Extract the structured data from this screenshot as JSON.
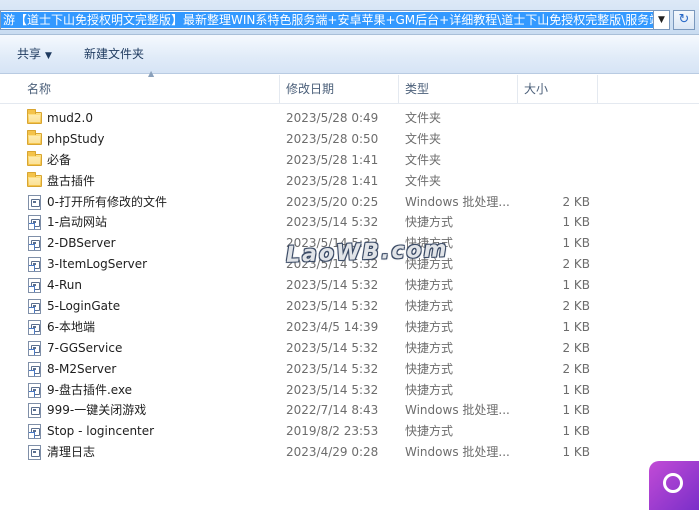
{
  "address_bar": {
    "path": "游【道士下山免授权明文完整版】最新整理WIN系特色服务端+安卓苹果+GM后台+详细教程\\道士下山免授权完整版\\服务端"
  },
  "toolbar": {
    "share_label": "共享",
    "new_folder_label": "新建文件夹"
  },
  "columns": {
    "name": "名称",
    "date": "修改日期",
    "type": "类型",
    "size": "大小"
  },
  "files": [
    {
      "name": "mud2.0",
      "date": "2023/5/28 0:49",
      "type": "文件夹",
      "size": "",
      "icon": "folder-icon"
    },
    {
      "name": "phpStudy",
      "date": "2023/5/28 0:50",
      "type": "文件夹",
      "size": "",
      "icon": "folder-icon"
    },
    {
      "name": "必备",
      "date": "2023/5/28 1:41",
      "type": "文件夹",
      "size": "",
      "icon": "folder-icon"
    },
    {
      "name": "盘古插件",
      "date": "2023/5/28 1:41",
      "type": "文件夹",
      "size": "",
      "icon": "folder-icon"
    },
    {
      "name": "0-打开所有修改的文件",
      "date": "2023/5/20 0:25",
      "type": "Windows 批处理...",
      "size": "2 KB",
      "icon": "batch-icon"
    },
    {
      "name": "1-启动网站",
      "date": "2023/5/14 5:32",
      "type": "快捷方式",
      "size": "1 KB",
      "icon": "shortcut-icon"
    },
    {
      "name": "2-DBServer",
      "date": "2023/5/14 5:32",
      "type": "快捷方式",
      "size": "1 KB",
      "icon": "shortcut-icon"
    },
    {
      "name": "3-ItemLogServer",
      "date": "2023/5/14 5:32",
      "type": "快捷方式",
      "size": "2 KB",
      "icon": "shortcut-icon"
    },
    {
      "name": "4-Run",
      "date": "2023/5/14 5:32",
      "type": "快捷方式",
      "size": "1 KB",
      "icon": "shortcut-icon"
    },
    {
      "name": "5-LoginGate",
      "date": "2023/5/14 5:32",
      "type": "快捷方式",
      "size": "2 KB",
      "icon": "shortcut-icon"
    },
    {
      "name": "6-本地端",
      "date": "2023/4/5 14:39",
      "type": "快捷方式",
      "size": "1 KB",
      "icon": "shortcut-icon"
    },
    {
      "name": "7-GGService",
      "date": "2023/5/14 5:32",
      "type": "快捷方式",
      "size": "2 KB",
      "icon": "shortcut-icon"
    },
    {
      "name": "8-M2Server",
      "date": "2023/5/14 5:32",
      "type": "快捷方式",
      "size": "2 KB",
      "icon": "shortcut-icon"
    },
    {
      "name": "9-盘古插件.exe",
      "date": "2023/5/14 5:32",
      "type": "快捷方式",
      "size": "1 KB",
      "icon": "shortcut-icon"
    },
    {
      "name": "999-一键关闭游戏",
      "date": "2022/7/14 8:43",
      "type": "Windows 批处理...",
      "size": "1 KB",
      "icon": "batch-icon"
    },
    {
      "name": "Stop - logincenter",
      "date": "2019/8/2 23:53",
      "type": "快捷方式",
      "size": "1 KB",
      "icon": "shortcut-icon"
    },
    {
      "name": "清理日志",
      "date": "2023/4/29 0:28",
      "type": "Windows 批处理...",
      "size": "1 KB",
      "icon": "batch-icon"
    }
  ],
  "watermark": "LaoWB.com",
  "colors": {
    "selection": "#3399ff",
    "toolbar": "#dde9f7",
    "folder": "#f4c34a",
    "badge": "#a63fd0"
  }
}
